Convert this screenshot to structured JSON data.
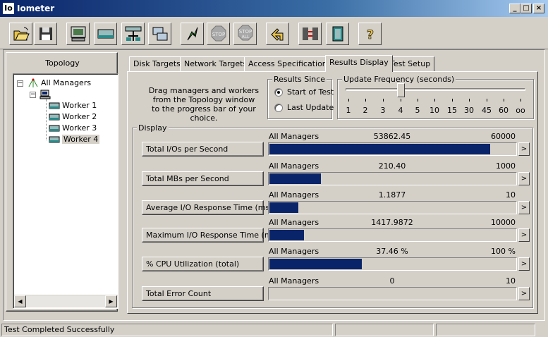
{
  "window": {
    "title": "Iometer",
    "icon_text": "Io",
    "minimize": "_",
    "maximize": "□",
    "close": "×"
  },
  "toolbar": {
    "buttons": [
      {
        "name": "open-icon"
      },
      {
        "name": "save-icon"
      },
      {
        "name": "display-icon"
      },
      {
        "name": "new-worker-icon"
      },
      {
        "name": "network-worker-icon"
      },
      {
        "name": "duplicate-worker-icon"
      },
      {
        "name": "start-icon"
      },
      {
        "name": "stop-icon",
        "label": "STOP"
      },
      {
        "name": "stop-all-icon",
        "label": "STOP",
        "sublabel": "ALL"
      },
      {
        "name": "reset-workers-icon"
      },
      {
        "name": "disconnect-icon"
      },
      {
        "name": "exit-icon"
      },
      {
        "name": "help-icon",
        "label": "?"
      }
    ]
  },
  "topology": {
    "title": "Topology",
    "root": "All Managers",
    "workers": [
      "Worker 1",
      "Worker 2",
      "Worker 3",
      "Worker 4"
    ],
    "selected": "Worker 4"
  },
  "tabs": [
    "Disk Targets",
    "Network Targets",
    "Access Specifications",
    "Results Display",
    "Test Setup"
  ],
  "active_tab": "Results Display",
  "help_text": [
    "Drag managers and workers",
    "from the Topology window",
    "to the progress bar of your choice."
  ],
  "results_since": {
    "legend": "Results Since",
    "options": [
      "Start of Test",
      "Last Update"
    ],
    "selected": "Start of Test"
  },
  "update_frequency": {
    "legend": "Update Frequency (seconds)",
    "ticks": [
      "1",
      "2",
      "3",
      "4",
      "5",
      "10",
      "15",
      "30",
      "45",
      "60",
      "oo"
    ],
    "selected": "4"
  },
  "display": {
    "legend": "Display",
    "metrics": [
      {
        "label": "Total I/Os per Second",
        "source": "All Managers",
        "value": "53862.45",
        "max": "60000",
        "fill": 0.8977
      },
      {
        "label": "Total MBs per Second",
        "source": "All Managers",
        "value": "210.40",
        "max": "1000",
        "fill": 0.2104
      },
      {
        "label": "Average I/O Response Time (ms)",
        "source": "All Managers",
        "value": "1.1877",
        "max": "10",
        "fill": 0.1188
      },
      {
        "label": "Maximum I/O Response Time (ms)",
        "source": "All Managers",
        "value": "1417.9872",
        "max": "10000",
        "fill": 0.1418
      },
      {
        "label": "% CPU Utilization (total)",
        "source": "All Managers",
        "value": "37.46 %",
        "max": "100 %",
        "fill": 0.3746
      },
      {
        "label": "Total Error Count",
        "source": "All Managers",
        "value": "0",
        "max": "10",
        "fill": 0
      }
    ],
    "arrow": ">"
  },
  "status": {
    "message": "Test Completed Successfully"
  },
  "colors": {
    "bar": "#0a246a",
    "face": "#d4d0c8"
  }
}
